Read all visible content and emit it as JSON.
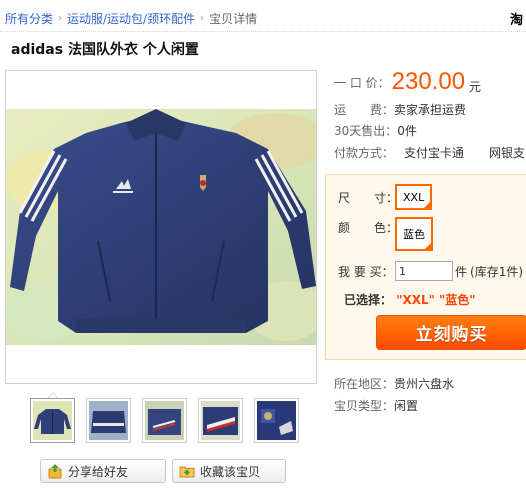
{
  "breadcrumb": {
    "items": [
      "所有分类",
      "运动服/运动包/颈环配件"
    ],
    "separator": "›",
    "current": "宝贝详情"
  },
  "corner_text": "淘",
  "product": {
    "title": "adidas 法国队外衣 个人闲置"
  },
  "price": {
    "label": "一 口 价：",
    "value": "230.00",
    "unit": "元"
  },
  "shipping": {
    "label": "运　　费：",
    "value": "卖家承担运费"
  },
  "sold": {
    "label": "30天售出：",
    "value": "0件"
  },
  "payment": {
    "label": "付款方式：",
    "methods": [
      "支付宝卡通",
      "网银支"
    ]
  },
  "options": {
    "size_label": "尺　　寸：",
    "size_value": "XXL",
    "color_label": "颜　　色：",
    "color_value": "蓝色",
    "qty_label": "我 要 买：",
    "qty_value": "1",
    "qty_unit": "件",
    "stock": "(库存1件)",
    "selected_label": "已选择：",
    "selected_values": "\"XXL\" \"蓝色\""
  },
  "buy_button": "立刻购买",
  "location": {
    "label": "所在地区：",
    "value": "贵州六盘水"
  },
  "category": {
    "label": "宝贝类型：",
    "value": "闲置"
  },
  "share_button": "分享给好友",
  "favorite_button": "收藏该宝贝",
  "colors": {
    "accent": "#ff5500",
    "link": "#3366cc",
    "jacket": "#2f3f7a",
    "panel_bg": "#fff9ed"
  }
}
